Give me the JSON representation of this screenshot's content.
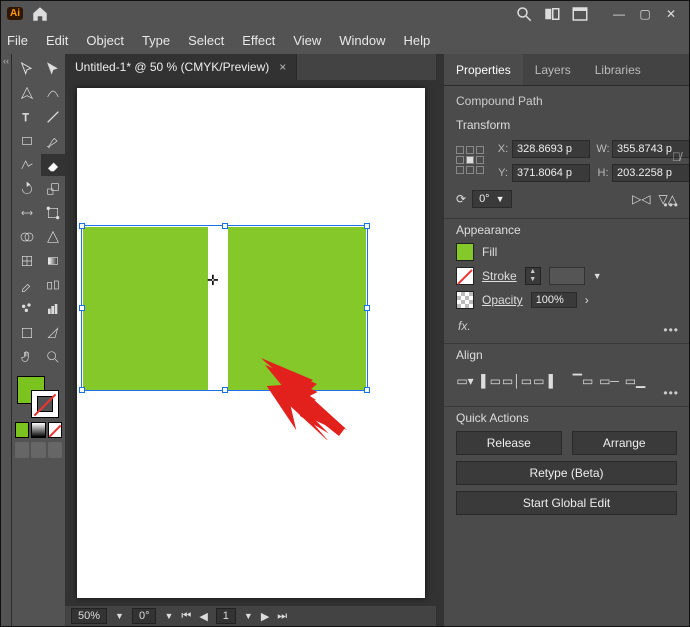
{
  "menu": {
    "file": "File",
    "edit": "Edit",
    "object": "Object",
    "type": "Type",
    "select": "Select",
    "effect": "Effect",
    "view": "View",
    "window": "Window",
    "help": "Help"
  },
  "document": {
    "tab_title": "Untitled-1* @ 50 % (CMYK/Preview)"
  },
  "status": {
    "zoom": "50%",
    "rotation": "0°",
    "artboard_nav": "1"
  },
  "panel_tabs": {
    "properties": "Properties",
    "layers": "Layers",
    "libraries": "Libraries"
  },
  "properties": {
    "selection_label": "Compound Path",
    "transform": {
      "title": "Transform",
      "x_label": "X:",
      "y_label": "Y:",
      "w_label": "W:",
      "h_label": "H:",
      "x": "328.8693 p",
      "y": "371.8064 p",
      "w": "355.8743 p",
      "h": "203.2258 p",
      "rotate": "0°"
    },
    "appearance": {
      "title": "Appearance",
      "fill_label": "Fill",
      "stroke_label": "Stroke",
      "opacity_label": "Opacity",
      "opacity_value": "100%",
      "fx_label": "fx."
    },
    "align": {
      "title": "Align"
    },
    "quick_actions": {
      "title": "Quick Actions",
      "release": "Release",
      "arrange": "Arrange",
      "retype": "Retype (Beta)",
      "global_edit": "Start Global Edit"
    }
  }
}
